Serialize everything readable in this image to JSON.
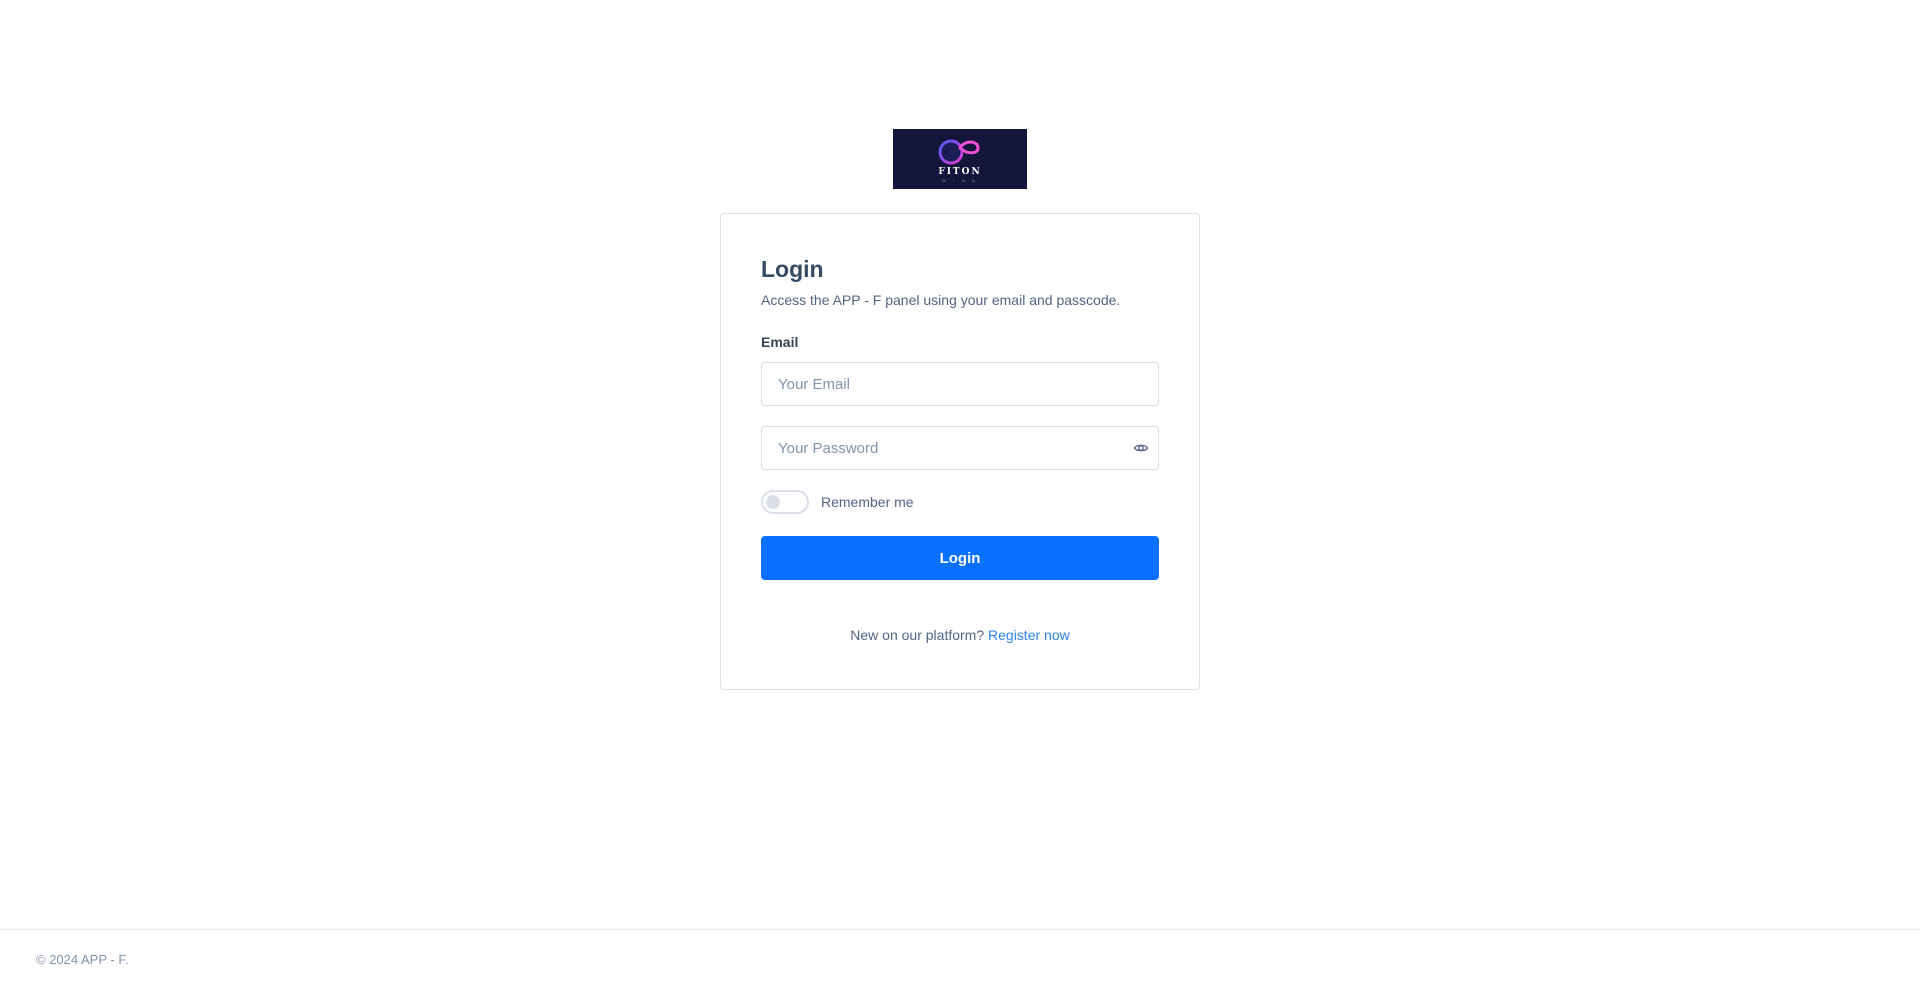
{
  "brand": {
    "logo_text": "FITON",
    "logo_subtext": "W·I·N·D",
    "logo_bg": "#13153a",
    "accent": "#0971fe"
  },
  "login": {
    "title": "Login",
    "subtitle": "Access the APP - F panel using your email and passcode.",
    "email_label": "Email",
    "email_placeholder": "Your Email",
    "email_value": "",
    "password_placeholder": "Your Password",
    "password_value": "",
    "password_toggle_icon": "eye-icon",
    "remember_label": "Remember me",
    "remember_checked": false,
    "submit_label": "Login",
    "register_prompt": "New on our platform?",
    "register_link": "Register now"
  },
  "footer": {
    "copyright": "© 2024 APP - F."
  }
}
